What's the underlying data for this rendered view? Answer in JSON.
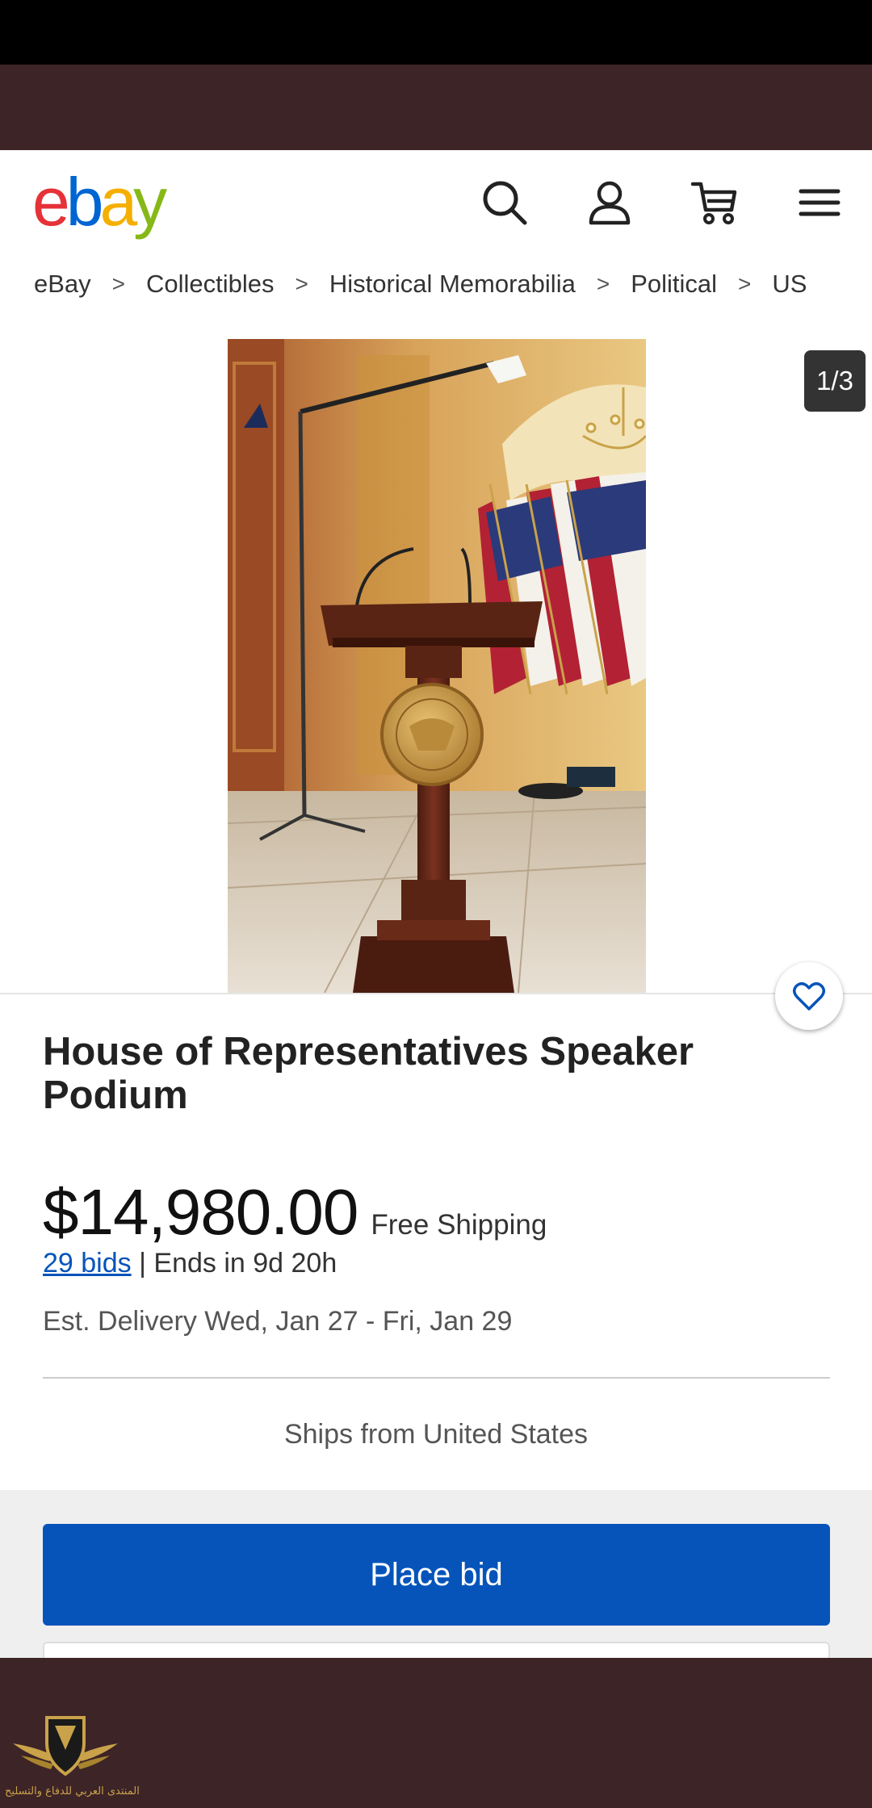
{
  "header": {
    "logo_letters": [
      "e",
      "b",
      "a",
      "y"
    ],
    "logo_colors": [
      "#e53238",
      "#0064d2",
      "#f5af02",
      "#86b817"
    ]
  },
  "icons": {
    "search": "search-icon",
    "account": "user-icon",
    "cart": "cart-icon",
    "menu": "hamburger-menu-icon"
  },
  "breadcrumb": {
    "items": [
      "eBay",
      "Collectibles",
      "Historical Memorabilia",
      "Political",
      "US"
    ],
    "separator": ">"
  },
  "gallery": {
    "counter": "1/3"
  },
  "listing": {
    "title": "House of Representatives Speaker Podium",
    "price": "$14,980.00",
    "shipping": "Free Shipping",
    "bids": "29 bids",
    "bids_separator": "|",
    "ends": "Ends in 9d 20h",
    "delivery": "Est. Delivery Wed, Jan 27 - Fri, Jan 29",
    "ships_from": "Ships from United States"
  },
  "actions": {
    "place_bid": "Place bid"
  },
  "watermark": {
    "text": "المنتدى العربي للدفاع والتسليح"
  },
  "colors": {
    "frame": "#3d2427",
    "primary_button": "#0654ba",
    "link": "#0654ba"
  }
}
